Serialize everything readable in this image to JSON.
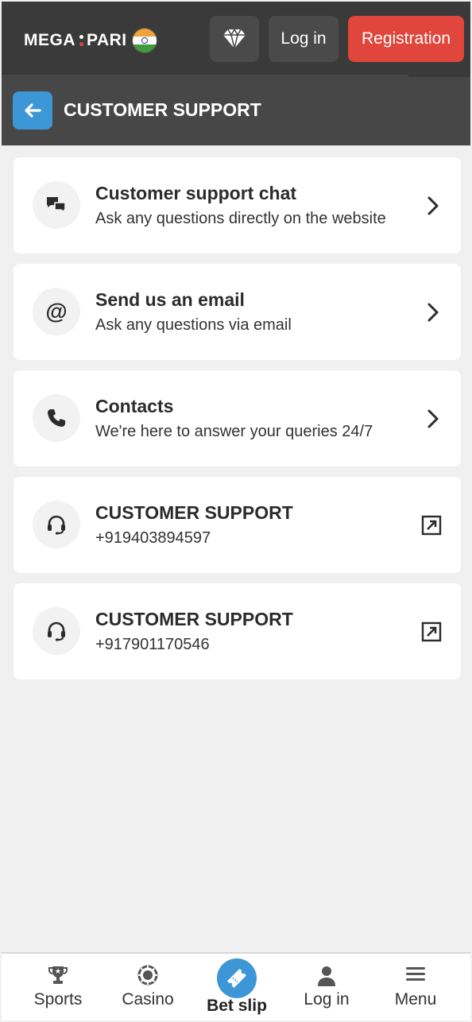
{
  "header": {
    "logo_left": "MEGA",
    "logo_right": "PARI",
    "login_label": "Log in",
    "register_label": "Registration"
  },
  "section": {
    "title": "CUSTOMER SUPPORT"
  },
  "cards": [
    {
      "title": "Customer support chat",
      "subtitle": "Ask any questions directly on the website",
      "icon": "chat-icon",
      "action": "chevron"
    },
    {
      "title": "Send us an email",
      "subtitle": "Ask any questions via email",
      "icon": "at-icon",
      "action": "chevron"
    },
    {
      "title": "Contacts",
      "subtitle": "We're here to answer your queries 24/7",
      "icon": "phone-icon",
      "action": "chevron"
    },
    {
      "title": "CUSTOMER SUPPORT",
      "subtitle": "+919403894597",
      "icon": "headset-icon",
      "action": "external"
    },
    {
      "title": "CUSTOMER SUPPORT",
      "subtitle": "+917901170546",
      "icon": "headset-icon",
      "action": "external"
    }
  ],
  "bottom_nav": [
    {
      "label": "Sports",
      "icon": "trophy-icon"
    },
    {
      "label": "Casino",
      "icon": "casino-chip-icon"
    },
    {
      "label": "Bet slip",
      "icon": "ticket-icon"
    },
    {
      "label": "Log in",
      "icon": "user-icon"
    },
    {
      "label": "Menu",
      "icon": "menu-icon"
    }
  ],
  "colors": {
    "header_bg": "#3a3a3a",
    "section_bg": "#474747",
    "accent_blue": "#3d96d6",
    "register_red": "#e0463b",
    "page_bg": "#f0f0f0"
  }
}
